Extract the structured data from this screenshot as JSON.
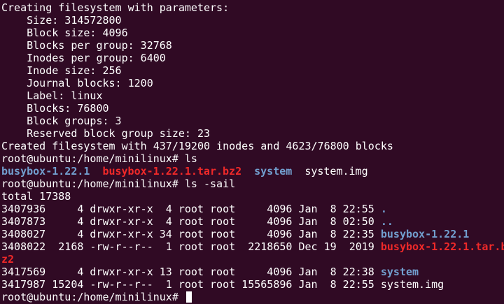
{
  "terminal": {
    "mkfs_header": "Creating filesystem with parameters:",
    "params": [
      "    Size: 314572800",
      "    Block size: 4096",
      "    Blocks per group: 32768",
      "    Inodes per group: 6400",
      "    Inode size: 256",
      "    Journal blocks: 1200",
      "    Label: linux",
      "    Blocks: 76800",
      "    Block groups: 3",
      "    Reserved block group size: 23"
    ],
    "mkfs_result": "Created filesystem with 437/19200 inodes and 4623/76800 blocks",
    "prompt": "root@ubuntu:/home/minilinux# ",
    "cmd1": "ls",
    "ls_items": [
      {
        "name": "busybox-1.22.1",
        "kind": "dir"
      },
      {
        "name": "busybox-1.22.1.tar.bz2",
        "kind": "archive"
      },
      {
        "name": "system",
        "kind": "dir"
      },
      {
        "name": "system.img",
        "kind": "plain"
      }
    ],
    "cmd2": "ls -sail",
    "total": "total 17388",
    "listing": [
      {
        "prefix": "3407936     4 drwxr-xr-x  4 root root     4096 Jan  8 22:55 ",
        "name": ".",
        "kind": "dir"
      },
      {
        "prefix": "3407873     4 drwxr-xr-x  4 root root     4096 Jan  8 02:50 ",
        "name": "..",
        "kind": "dir"
      },
      {
        "prefix": "3408027     4 drwxr-xr-x 34 root root     4096 Jan  8 22:35 ",
        "name": "busybox-1.22.1",
        "kind": "dir"
      },
      {
        "prefix": "3408022  2168 -rw-r--r--  1 root root  2218650 Dec 19  2019 ",
        "name": "busybox-1.22.1.tar.b",
        "kind": "archive"
      },
      {
        "prefix": "",
        "name": "z2",
        "kind": "archive"
      },
      {
        "prefix": "3417569     4 drwxr-xr-x 13 root root     4096 Jan  8 22:38 ",
        "name": "system",
        "kind": "dir"
      },
      {
        "prefix": "3417987 15204 -rw-r--r--  1 root root 15565896 Jan  8 22:55 ",
        "name": "system.img",
        "kind": "plain"
      }
    ],
    "colors": {
      "background": "#300a24",
      "text": "#ffffff",
      "directory": "#729fcf",
      "archive": "#ef2929"
    }
  }
}
